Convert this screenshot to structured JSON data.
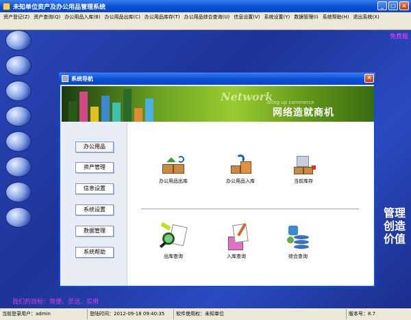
{
  "app": {
    "title": "未知单位资产及办公用品管理系统"
  },
  "window_buttons": {
    "minimize": "_",
    "maximize": "□",
    "close": "×"
  },
  "menu": [
    "资产登记(Z)",
    "资产查询(Q)",
    "办公用品入库(B)",
    "办公用品出库(C)",
    "办公用品库存(T)",
    "办公用品综合查询(U)",
    "信息设置(V)",
    "系统设置(Y)",
    "数据管理(I)",
    "系统帮助(H)",
    "退出系统(X)"
  ],
  "desktop": {
    "free_label": "免费版",
    "slogan": "我们的目标：简便、灵活、实用",
    "vertical_text": "管理创造价值"
  },
  "dialog": {
    "title": "系统导航",
    "close": "×",
    "banner": {
      "network": "Network",
      "sub": "bring up commerce",
      "cn": "网络造就商机"
    },
    "nav": [
      "办公用品",
      "资产管理",
      "信息设置",
      "系统设置",
      "数据管理",
      "系统帮助"
    ],
    "top_icons": [
      "办公用品出库",
      "办公用品入库",
      "当前库存"
    ],
    "bottom_icons": [
      "出库查询",
      "入库查询",
      "综合查询"
    ]
  },
  "status": {
    "user": "当前登录用户：admin",
    "login_time": "登陆时间：2012-09-18 09:40:35",
    "license": "软件使用权：未知单位",
    "version": "版本号：8.7"
  },
  "colors": {
    "title_blue": "#0a4fd6",
    "desktop_blue": "#1d3399",
    "accent_magenta": "#e040e0"
  }
}
